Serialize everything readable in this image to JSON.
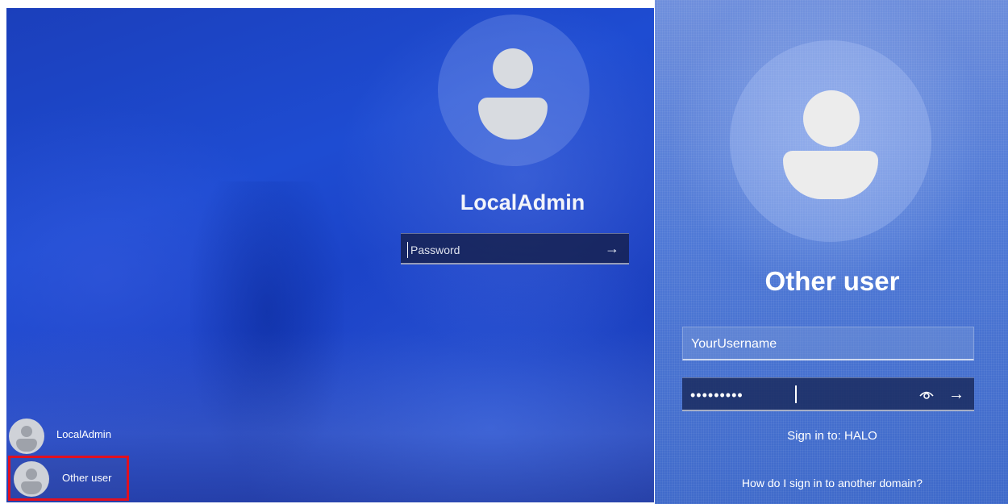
{
  "left_screen": {
    "user_name": "LocalAdmin",
    "password_placeholder": "Password",
    "submit_icon": "arrow-right-icon",
    "user_list": [
      {
        "name": "LocalAdmin",
        "selected": false
      },
      {
        "name": "Other user",
        "selected": true,
        "highlight_color": "#e01020"
      }
    ]
  },
  "right_screen": {
    "user_name": "Other user",
    "username_value": "YourUsername",
    "password_value": "•••••••••",
    "reveal_icon": "eye-icon",
    "submit_icon": "arrow-right-icon",
    "sign_in_to": "Sign in to: HALO",
    "help_link": "How do I sign in to another domain?"
  },
  "colors": {
    "background_blue": "#1e4cd2",
    "text": "#ffffff",
    "highlight_box": "#e01020"
  }
}
